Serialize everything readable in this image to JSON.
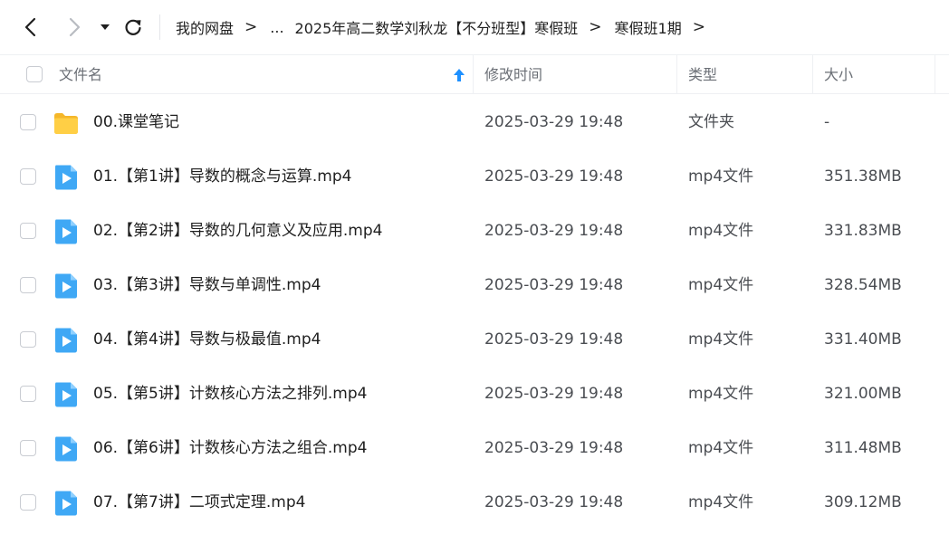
{
  "breadcrumb": {
    "root": "我的网盘",
    "ellipsis": "...",
    "folder": "2025年高二数学刘秋龙【不分班型】寒假班",
    "current": "寒假班1期",
    "separator": ">"
  },
  "icons": {
    "back": "chevron-left-icon",
    "forward": "chevron-right-icon",
    "history": "caret-down-icon",
    "refresh": "refresh-icon",
    "sort": "sort-up-arrow-icon",
    "folder": "folder-icon",
    "video": "video-file-icon"
  },
  "colors": {
    "accent": "#1e90ff",
    "folder": "#ffc938",
    "video": "#3fa8f5"
  },
  "columns": {
    "name": "文件名",
    "modified": "修改时间",
    "type": "类型",
    "size": "大小"
  },
  "files": [
    {
      "kind": "folder",
      "name": "00.课堂笔记",
      "modified": "2025-03-29 19:48",
      "type": "文件夹",
      "size": "-"
    },
    {
      "kind": "video",
      "name": "01.【第1讲】导数的概念与运算.mp4",
      "modified": "2025-03-29 19:48",
      "type": "mp4文件",
      "size": "351.38MB"
    },
    {
      "kind": "video",
      "name": "02.【第2讲】导数的几何意义及应用.mp4",
      "modified": "2025-03-29 19:48",
      "type": "mp4文件",
      "size": "331.83MB"
    },
    {
      "kind": "video",
      "name": "03.【第3讲】导数与单调性.mp4",
      "modified": "2025-03-29 19:48",
      "type": "mp4文件",
      "size": "328.54MB"
    },
    {
      "kind": "video",
      "name": "04.【第4讲】导数与极最值.mp4",
      "modified": "2025-03-29 19:48",
      "type": "mp4文件",
      "size": "331.40MB"
    },
    {
      "kind": "video",
      "name": "05.【第5讲】计数核心方法之排列.mp4",
      "modified": "2025-03-29 19:48",
      "type": "mp4文件",
      "size": "321.00MB"
    },
    {
      "kind": "video",
      "name": "06.【第6讲】计数核心方法之组合.mp4",
      "modified": "2025-03-29 19:48",
      "type": "mp4文件",
      "size": "311.48MB"
    },
    {
      "kind": "video",
      "name": "07.【第7讲】二项式定理.mp4",
      "modified": "2025-03-29 19:48",
      "type": "mp4文件",
      "size": "309.12MB"
    }
  ]
}
